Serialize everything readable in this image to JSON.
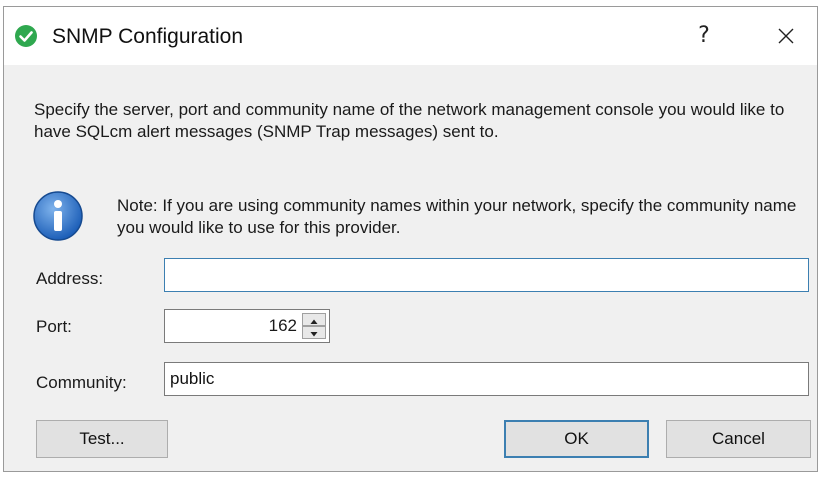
{
  "window": {
    "title": "SNMP Configuration",
    "help_glyph": "?",
    "app_icon": "check-circle-icon",
    "accent_color": "#2fa84f"
  },
  "content": {
    "description": "Specify the server, port and community name of the network management console you would like to have SQLcm alert messages (SNMP Trap messages) sent to.",
    "note": "Note: If you are using community names within your network, specify the community name you would like to use for this provider.",
    "note_icon": "info-icon"
  },
  "form": {
    "address_label": "Address:",
    "address_value": "",
    "port_label": "Port:",
    "port_value": "162",
    "community_label": "Community:",
    "community_value": "public"
  },
  "buttons": {
    "test": "Test...",
    "ok": "OK",
    "cancel": "Cancel"
  }
}
